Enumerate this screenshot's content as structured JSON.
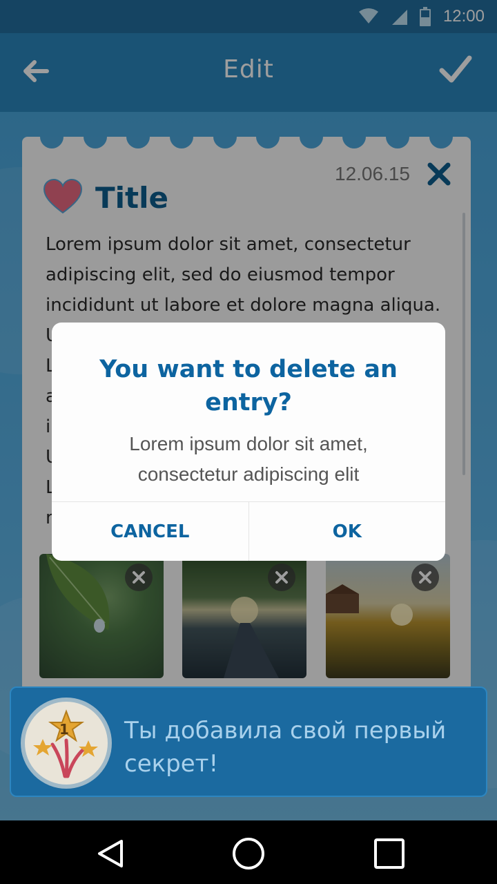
{
  "status_bar": {
    "time": "12:00",
    "icons": [
      "wifi-icon",
      "signal-icon",
      "battery-icon"
    ]
  },
  "app_bar": {
    "title": "Edit",
    "back_icon": "arrow-left-icon",
    "confirm_icon": "checkmark-icon"
  },
  "note": {
    "date": "12.06.15",
    "title": "Title",
    "body": "Lorem ipsum dolor sit amet, consectetur\nadipiscing elit, sed do eiusmod tempor\nincididunt ut labore et dolore magna aliqua.\nUt enim ad minim veniam, quis nostrud\nLorem ipsum dolor sit amet, consectetur\nadipiscing elit, sed do eiusmod tempor\nincididunt ut labore et dolore magna aliqua.\nUt enim ad minim veniam, quis nostrud\nLorem ipsum dolor sit amet, consectetur\nnisi ut aliquip ex ea commodo consequat.",
    "photos": [
      {
        "subject": "leaf with water drop",
        "remove_icon": "close-icon"
      },
      {
        "subject": "sunlit forest road",
        "remove_icon": "close-icon"
      },
      {
        "subject": "sunset over farm field",
        "remove_icon": "close-icon"
      }
    ]
  },
  "dialog": {
    "title": "You want to delete an entry?",
    "message": "Lorem ipsum dolor sit amet,\nconsectetur adipiscing elit",
    "cancel_label": "CANCEL",
    "ok_label": "OK"
  },
  "achievement": {
    "badge_number": "1",
    "text": "Ты добавила свой первый секрет!"
  },
  "nav_bar": {
    "icons": [
      "back-triangle-icon",
      "home-circle-icon",
      "recents-square-icon"
    ]
  },
  "colors": {
    "primary": "#2b86bd",
    "accent": "#0d64a0",
    "banner": "#1b6aa0"
  }
}
